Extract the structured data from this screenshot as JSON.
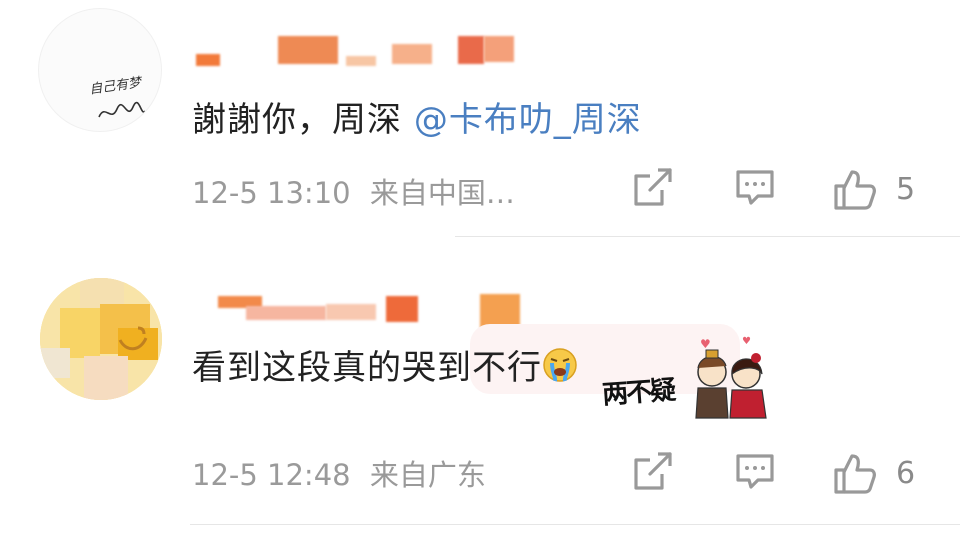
{
  "colors": {
    "text": "#222222",
    "meta": "#9a9a9a",
    "mention": "#4a7fc1",
    "divider": "#e6e6e6"
  },
  "comments": [
    {
      "avatar_icon": "signature-avatar",
      "avatar_text": "自己有梦",
      "text": "謝謝你，周深 ",
      "mention": "@卡布叻_周深",
      "time": "12-5 13:10",
      "source": "来自中国…",
      "like_count": "5",
      "icons": [
        "share-icon",
        "comment-icon",
        "thumbs-up-icon"
      ]
    },
    {
      "avatar_icon": "emoji-avatar",
      "text": "看到这段真的哭到不行",
      "emoji": "crying-face-emoji",
      "sticker_text": "两不疑",
      "time": "12-5 12:48",
      "source": "来自广东",
      "like_count": "6",
      "icons": [
        "share-icon",
        "comment-icon",
        "thumbs-up-icon"
      ]
    }
  ]
}
